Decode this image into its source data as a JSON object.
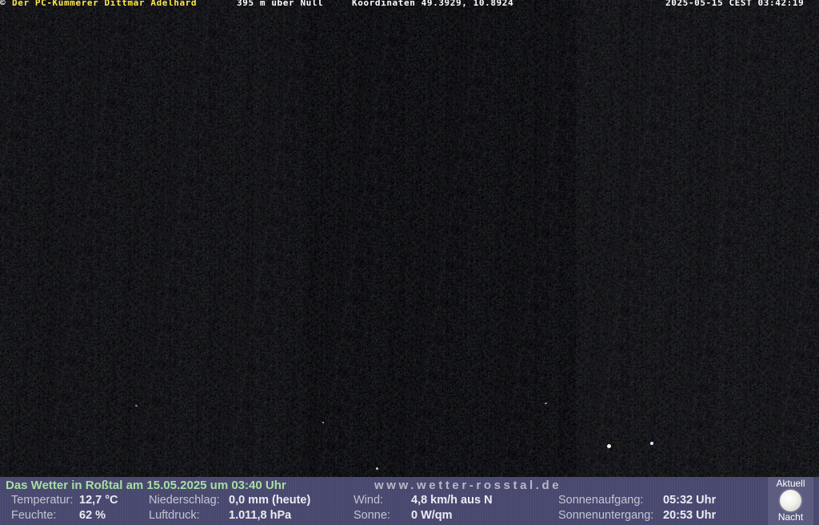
{
  "overlay_top": {
    "copyright_symbol": "©",
    "owner": "Der PC-Kümmerer Dittmar Adelhard",
    "altitude": "395 m über Null",
    "coordinates": "Koordinaten 49.3929, 10.8924",
    "timestamp": "2025-05-15 CEST 03:42:19"
  },
  "weather_panel": {
    "title": "Das Wetter in Roßtal am 15.05.2025 um 03:40 Uhr",
    "url": "www.wetter-rosstal.de",
    "temperature": {
      "label": "Temperatur:",
      "value": "12,7 °C"
    },
    "humidity": {
      "label": "Feuchte:",
      "value": "62 %"
    },
    "precipitation": {
      "label": "Niederschlag:",
      "value": "0,0 mm (heute)"
    },
    "pressure": {
      "label": "Luftdruck:",
      "value": "1.011,8 hPa"
    },
    "wind": {
      "label": "Wind:",
      "value": "4,8 km/h aus N"
    },
    "sun": {
      "label": "Sonne:",
      "value": "0 W/qm"
    },
    "sunrise": {
      "label": "Sonnenaufgang:",
      "value": "05:32 Uhr"
    },
    "sunset": {
      "label": "Sonnenuntergang:",
      "value": "20:53 Uhr"
    },
    "moon": {
      "top_label": "Aktuell",
      "bottom_label": "Nacht",
      "icon": "full-moon-icon"
    }
  },
  "colors": {
    "owner_text": "#ffe84a",
    "title_text": "#a7dfa0",
    "panel_bg": "#4a4a72"
  }
}
